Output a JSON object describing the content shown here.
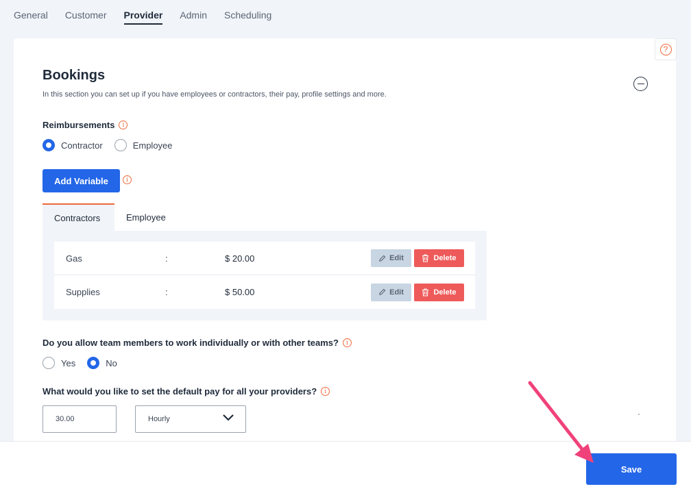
{
  "top_tabs": [
    {
      "label": "General"
    },
    {
      "label": "Customer"
    },
    {
      "label": "Provider",
      "active": true
    },
    {
      "label": "Admin"
    },
    {
      "label": "Scheduling"
    }
  ],
  "help": {
    "glyph": "?"
  },
  "section": {
    "title": "Bookings",
    "description": "In this section you can set up if you have employees or contractors, their pay, profile settings and more."
  },
  "reimbursements": {
    "label": "Reimbursements",
    "options": [
      "Contractor",
      "Employee"
    ],
    "selected": "Contractor"
  },
  "add_variable_label": "Add Variable",
  "sub_tabs": [
    {
      "label": "Contractors",
      "active": true
    },
    {
      "label": "Employee"
    }
  ],
  "rows": [
    {
      "name": "Gas",
      "sep": ":",
      "value": "$ 20.00",
      "edit": "Edit",
      "delete": "Delete"
    },
    {
      "name": "Supplies",
      "sep": ":",
      "value": "$ 50.00",
      "edit": "Edit",
      "delete": "Delete"
    }
  ],
  "team_question": {
    "label": "Do you allow team members to work individually or with other teams?",
    "options": [
      "Yes",
      "No"
    ],
    "selected": "No"
  },
  "pay_question": {
    "label": "What would you like to set the default pay for all your providers?",
    "amount": "30.00",
    "period": "Hourly"
  },
  "save_label": "Save",
  "colors": {
    "primary": "#2366e8",
    "accent_orange": "#ee6a3c",
    "danger": "#ee5a5a",
    "arrow": "#f0427a"
  }
}
